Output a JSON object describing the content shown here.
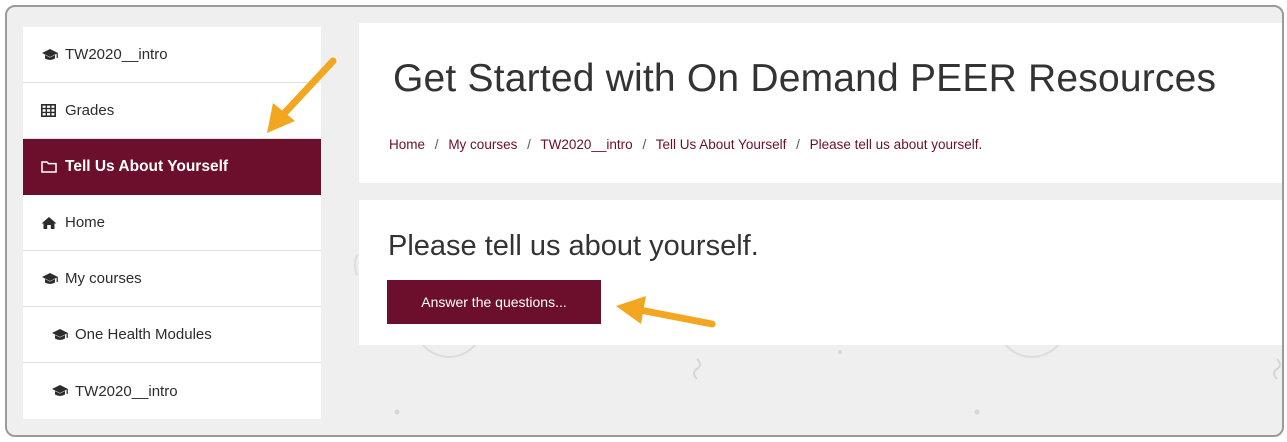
{
  "sidebar": {
    "items": [
      {
        "label": "TW2020__intro",
        "icon": "graduation-cap-icon"
      },
      {
        "label": "Grades",
        "icon": "table-icon"
      },
      {
        "label": "Tell Us About Yourself",
        "icon": "folder-icon",
        "active": true
      },
      {
        "label": "Home",
        "icon": "home-icon"
      },
      {
        "label": "My courses",
        "icon": "graduation-cap-icon"
      },
      {
        "label": "One Health Modules",
        "icon": "graduation-cap-icon"
      },
      {
        "label": "TW2020__intro",
        "icon": "graduation-cap-icon"
      }
    ]
  },
  "header": {
    "title": "Get Started with On Demand PEER Resources",
    "breadcrumb": [
      "Home",
      "My courses",
      "TW2020__intro",
      "Tell Us About Yourself",
      "Please tell us about yourself."
    ],
    "separator": "/"
  },
  "main": {
    "heading": "Please tell us about yourself.",
    "button_label": "Answer the questions..."
  },
  "colors": {
    "accent": "#6c0f2d",
    "annotation_arrow": "#f3a61f",
    "background": "#efefef"
  }
}
